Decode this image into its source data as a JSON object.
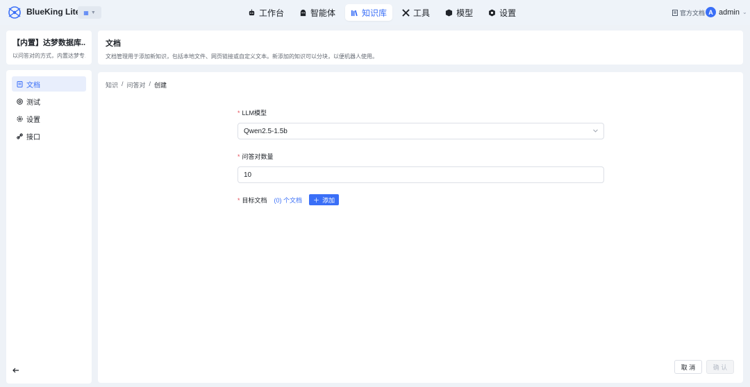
{
  "app": {
    "brand": "BlueKing Lite"
  },
  "nav": [
    {
      "label": "工作台",
      "icon": "robot-icon"
    },
    {
      "label": "智能体",
      "icon": "agent-icon"
    },
    {
      "label": "知识库",
      "icon": "library-icon",
      "active": true
    },
    {
      "label": "工具",
      "icon": "tools-icon"
    },
    {
      "label": "模型",
      "icon": "cube-icon"
    },
    {
      "label": "设置",
      "icon": "gear-icon"
    }
  ],
  "topright": {
    "docs_label": "官方文档",
    "user": "admin",
    "avatar_letter": "A"
  },
  "kb": {
    "title": "【内置】达梦数据库...",
    "desc": "以问答对的方式，内置达梦专..."
  },
  "header": {
    "title": "文档",
    "desc": "文档管理用于添加新知识，包括本地文件、网页链接或自定义文本。新添加的知识可以分块，以便机器人使用。"
  },
  "sidebar": {
    "items": [
      {
        "label": "文档",
        "icon": "document-icon",
        "active": true
      },
      {
        "label": "测试",
        "icon": "test-icon"
      },
      {
        "label": "设置",
        "icon": "settings-icon"
      },
      {
        "label": "接口",
        "icon": "link-icon"
      }
    ]
  },
  "breadcrumb": {
    "items": [
      "知识",
      "问答对",
      "创建"
    ],
    "sep": "/"
  },
  "form": {
    "llm_label": "LLM模型",
    "llm_value": "Qwen2.5-1.5b",
    "qa_count_label": "问答对数量",
    "qa_count_value": "10",
    "target_label": "目标文档",
    "target_count": "(0) 个文档",
    "add_label": "添加",
    "required_mark": "*"
  },
  "footer": {
    "cancel": "取 消",
    "confirm": "确 认"
  },
  "colors": {
    "accent": "#3a6ff7",
    "required": "#e34d59"
  }
}
